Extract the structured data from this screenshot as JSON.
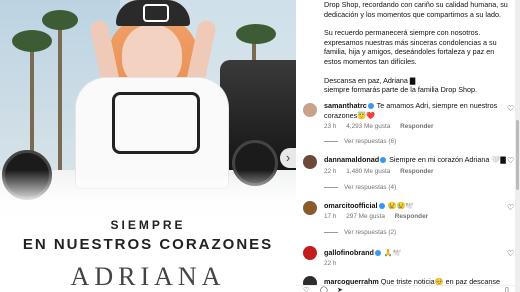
{
  "post_image": {
    "line1": "SIEMPRE",
    "line2": "EN NUESTROS CORAZONES",
    "name": "ADRIANA"
  },
  "caption": {
    "para1": "Drop Shop, recordando con cariño su calidad humana, su dedicación y los momentos que compartimos a su lado.",
    "para2": "Su recuerdo permanecerá siempre con nosotros. expresamos nuestras más sinceras condolencias a su familia, hija y amigos, deseándoles fortaleza y paz en estos momentos tan difíciles.",
    "para3a": "Descansa en paz, Adriana ▇",
    "para3b": "siempre formarás parte de la familia Drop Shop."
  },
  "comments": [
    {
      "user": "samanthatrc",
      "text": "Te amamos Adri, siempre en nuestros corazones😇❤️",
      "time": "23 h",
      "likes": "4,293 Me gusta",
      "reply": "Responder",
      "view_replies": "Ver respuestas (6)",
      "avatar_color": "#c9a28c"
    },
    {
      "user": "dannamaldonad",
      "text": "Siempre en mi corazón Adriana 🤍▇",
      "time": "22 h",
      "likes": "1,480 Me gusta",
      "reply": "Responder",
      "view_replies": "Ver respuestas (4)",
      "avatar_color": "#6b4a3a"
    },
    {
      "user": "omarcitoofficial",
      "text": "😢😢🕊️",
      "time": "17 h",
      "likes": "297 Me gusta",
      "reply": "Responder",
      "view_replies": "Ver respuestas (2)",
      "avatar_color": "#8a5b2a"
    },
    {
      "user": "gallofinobrand",
      "text": "🙏🕊️",
      "time": "22 h",
      "likes": "",
      "reply": "",
      "view_replies": "",
      "avatar_color": "#c31c1c"
    },
    {
      "user": "marcoguerrahm",
      "text": "Que triste noticia🥺 en paz descanse",
      "time": "",
      "likes": "",
      "reply": "",
      "view_replies": "",
      "avatar_color": "#2d2d2d"
    }
  ],
  "colors": {
    "verified": "#3897f0",
    "meta": "#737373"
  }
}
